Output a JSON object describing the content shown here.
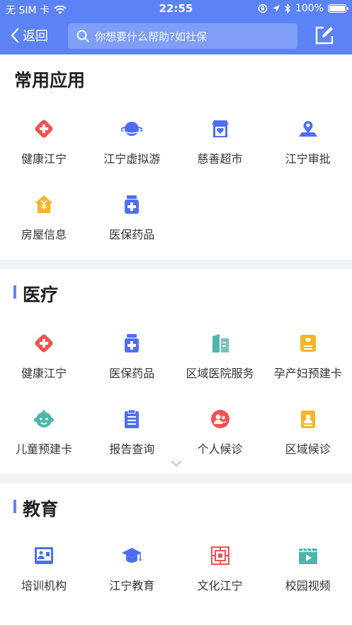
{
  "status_bar": {
    "carrier": "无 SIM 卡",
    "time": "22:55",
    "battery": "100%"
  },
  "nav": {
    "back_label": "返回",
    "search_placeholder": "你想要什么帮助?如社保"
  },
  "sections": {
    "common": {
      "title": "常用应用",
      "items": [
        {
          "label": "健康江宁",
          "icon": "health-cross-icon",
          "color": "#ef5350"
        },
        {
          "label": "江宁虚拟游",
          "icon": "planet-icon",
          "color": "#4e6ef2"
        },
        {
          "label": "慈善超市",
          "icon": "shop-heart-icon",
          "color": "#4e6ef2"
        },
        {
          "label": "江宁审批",
          "icon": "map-pin-icon",
          "color": "#4e6ef2"
        },
        {
          "label": "房屋信息",
          "icon": "house-yuan-icon",
          "color": "#f5b529"
        },
        {
          "label": "医保药品",
          "icon": "medicine-bottle-icon",
          "color": "#4e6ef2"
        }
      ]
    },
    "medical": {
      "title": "医疗",
      "items": [
        {
          "label": "健康江宁",
          "icon": "health-cross-icon",
          "color": "#ef5350"
        },
        {
          "label": "医保药品",
          "icon": "medicine-bottle-icon",
          "color": "#4e6ef2"
        },
        {
          "label": "区域医院服务",
          "icon": "hospital-building-icon",
          "color": "#4db6ac"
        },
        {
          "label": "孕产妇预建卡",
          "icon": "maternal-card-icon",
          "color": "#f5b529"
        },
        {
          "label": "儿童预建卡",
          "icon": "child-face-icon",
          "color": "#4db6ac"
        },
        {
          "label": "报告查询",
          "icon": "report-clipboard-icon",
          "color": "#4e6ef2"
        },
        {
          "label": "个人候诊",
          "icon": "person-waiting-icon",
          "color": "#ef5350"
        },
        {
          "label": "区域候诊",
          "icon": "area-waiting-icon",
          "color": "#f5b529"
        }
      ]
    },
    "education": {
      "title": "教育",
      "items": [
        {
          "label": "培训机构",
          "icon": "training-board-icon",
          "color": "#4e6ef2"
        },
        {
          "label": "江宁教育",
          "icon": "graduation-cap-icon",
          "color": "#4e6ef2"
        },
        {
          "label": "文化江宁",
          "icon": "culture-pattern-icon",
          "color": "#ef5350"
        },
        {
          "label": "校园视频",
          "icon": "video-play-icon",
          "color": "#4db6ac"
        }
      ]
    }
  },
  "colors": {
    "header": "#5b83f5",
    "accent": "#5b83f5"
  }
}
